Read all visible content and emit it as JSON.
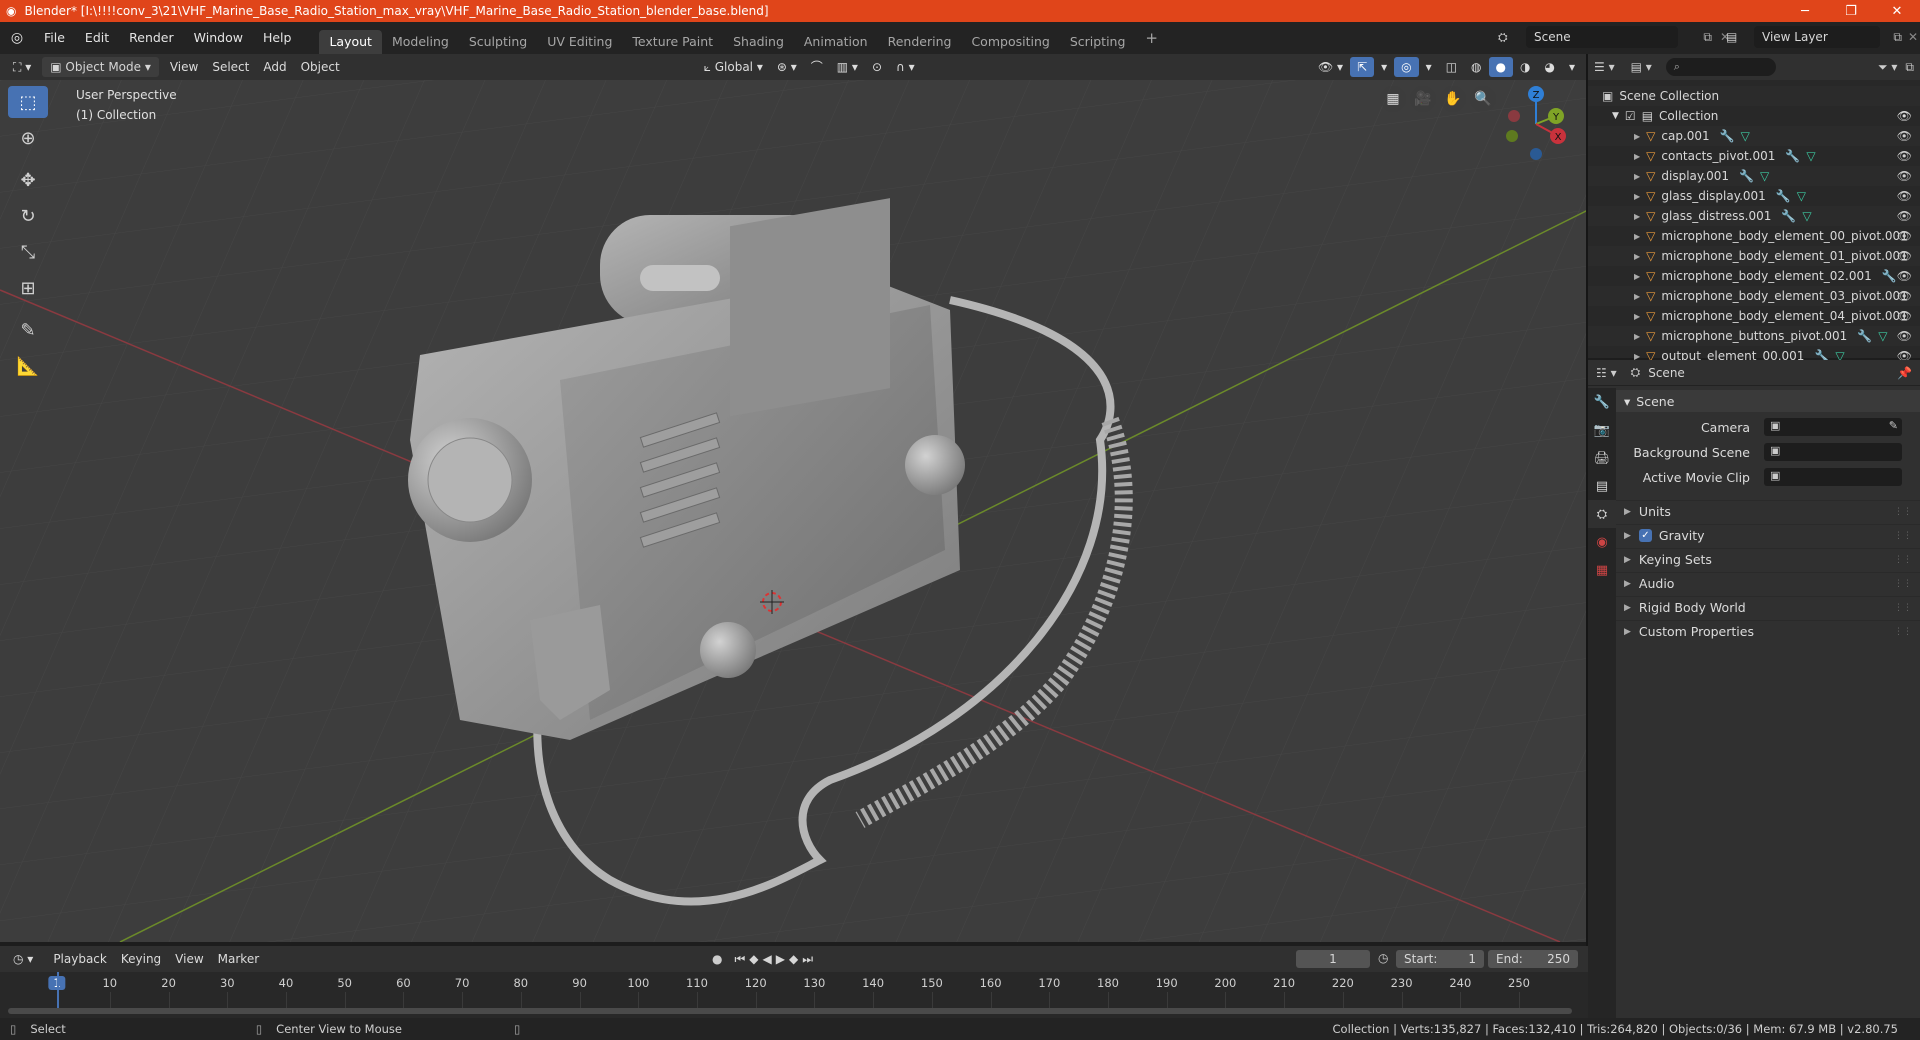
{
  "window": {
    "title": "Blender* [I:\\!!!!conv_3\\21\\VHF_Marine_Base_Radio_Station_max_vray\\VHF_Marine_Base_Radio_Station_blender_base.blend]"
  },
  "menu": {
    "items": [
      "File",
      "Edit",
      "Render",
      "Window",
      "Help"
    ]
  },
  "workspaces": {
    "tabs": [
      "Layout",
      "Modeling",
      "Sculpting",
      "UV Editing",
      "Texture Paint",
      "Shading",
      "Animation",
      "Rendering",
      "Compositing",
      "Scripting"
    ],
    "active": "Layout",
    "add": "+"
  },
  "scene_selector": {
    "value": "Scene"
  },
  "view_layer": {
    "value": "View Layer"
  },
  "viewport_header": {
    "mode": "Object Mode",
    "menus": [
      "View",
      "Select",
      "Add",
      "Object"
    ],
    "transform_orientation": "Global"
  },
  "viewport": {
    "perspective": "User Perspective",
    "collection": "(1) Collection",
    "gizmo_axes": [
      "Z",
      "Y",
      "X"
    ]
  },
  "outliner": {
    "root": "Scene Collection",
    "collection": "Collection",
    "items": [
      {
        "name": "cap.001",
        "mod": true,
        "mesh": true
      },
      {
        "name": "contacts_pivot.001",
        "mod": true,
        "mesh": true
      },
      {
        "name": "display.001",
        "mod": true,
        "mesh": true
      },
      {
        "name": "glass_display.001",
        "mod": true,
        "mesh": true
      },
      {
        "name": "glass_distress.001",
        "mod": true,
        "mesh": true
      },
      {
        "name": "microphone_body_element_00_pivot.001",
        "mod": false,
        "mesh": false
      },
      {
        "name": "microphone_body_element_01_pivot.001",
        "mod": false,
        "mesh": false
      },
      {
        "name": "microphone_body_element_02.001",
        "mod": true,
        "mesh": false
      },
      {
        "name": "microphone_body_element_03_pivot.001",
        "mod": false,
        "mesh": false
      },
      {
        "name": "microphone_body_element_04_pivot.001",
        "mod": false,
        "mesh": false
      },
      {
        "name": "microphone_buttons_pivot.001",
        "mod": true,
        "mesh": true
      },
      {
        "name": "output_element_00.001",
        "mod": true,
        "mesh": true
      }
    ]
  },
  "properties": {
    "context": "Scene",
    "panel": "Scene",
    "fields": [
      {
        "label": "Camera"
      },
      {
        "label": "Background Scene"
      },
      {
        "label": "Active Movie Clip"
      }
    ],
    "sections": [
      "Units",
      "Gravity",
      "Keying Sets",
      "Audio",
      "Rigid Body World",
      "Custom Properties"
    ],
    "gravity_checked": true
  },
  "timeline": {
    "menus": [
      "Playback",
      "Keying",
      "View",
      "Marker"
    ],
    "current_frame": "1",
    "start_label": "Start:",
    "start": "1",
    "end_label": "End:",
    "end": "250",
    "ticks": [
      "1",
      "10",
      "20",
      "30",
      "40",
      "50",
      "60",
      "70",
      "80",
      "90",
      "100",
      "110",
      "120",
      "130",
      "140",
      "150",
      "160",
      "170",
      "180",
      "190",
      "200",
      "210",
      "220",
      "230",
      "240",
      "250"
    ]
  },
  "statusbar": {
    "left": "Select",
    "middle": "Center View to Mouse",
    "right": "Collection | Verts:135,827 | Faces:132,410 | Tris:264,820 | Objects:0/36 | Mem: 67.9 MB | v2.80.75"
  },
  "colors": {
    "titlebar": "#e0451a",
    "accent": "#4772b3",
    "viewport": "#3d3d3d",
    "x_axis": "#c8323c",
    "y_axis": "#7fa326",
    "z_axis": "#2f7fd6"
  }
}
